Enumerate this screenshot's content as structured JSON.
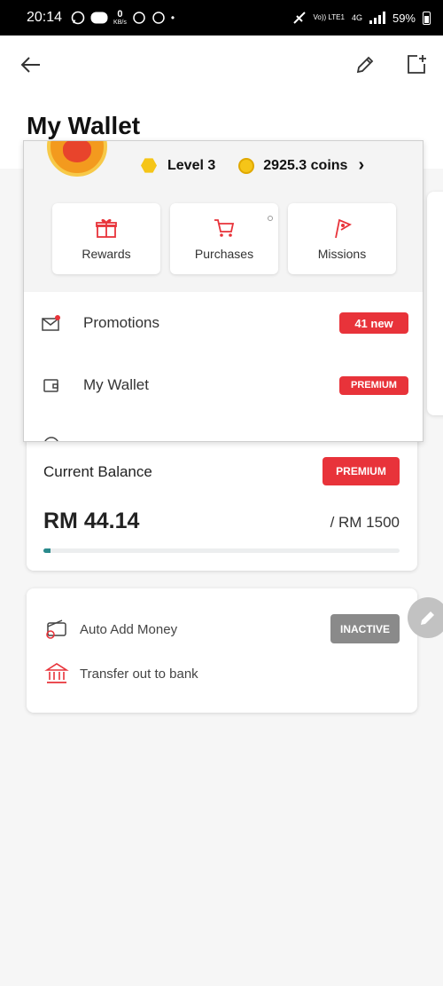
{
  "status_bar": {
    "time": "20:14",
    "speed": "0",
    "speed_unit": "KB/s",
    "network": "Vo)) LTE1",
    "network_type": "4G",
    "battery": "59%"
  },
  "header": {
    "title": "My Wallet"
  },
  "popup": {
    "level": "Level 3",
    "coins": "2925.3 coins",
    "tiles": [
      {
        "label": "Rewards",
        "icon": "gift-icon"
      },
      {
        "label": "Purchases",
        "icon": "cart-icon"
      },
      {
        "label": "Missions",
        "icon": "flag-icon"
      }
    ],
    "menu": [
      {
        "label": "Promotions",
        "badge": "41 new",
        "icon": "mail-icon"
      },
      {
        "label": "My Wallet",
        "badge": "PREMIUM",
        "icon": "wallet-icon"
      }
    ]
  },
  "balance": {
    "label": "Current Balance",
    "badge": "PREMIUM",
    "amount": "RM 44.14",
    "limit": "/ RM 1500",
    "fill_fraction": 0.02
  },
  "options": {
    "auto_add": {
      "label": "Auto Add Money",
      "status": "INACTIVE"
    },
    "transfer": {
      "label": "Transfer out to bank"
    }
  },
  "colors": {
    "accent_red": "#e8333a",
    "progress_teal": "#2a8a8c",
    "inactive_gray": "#8a8a8a"
  }
}
